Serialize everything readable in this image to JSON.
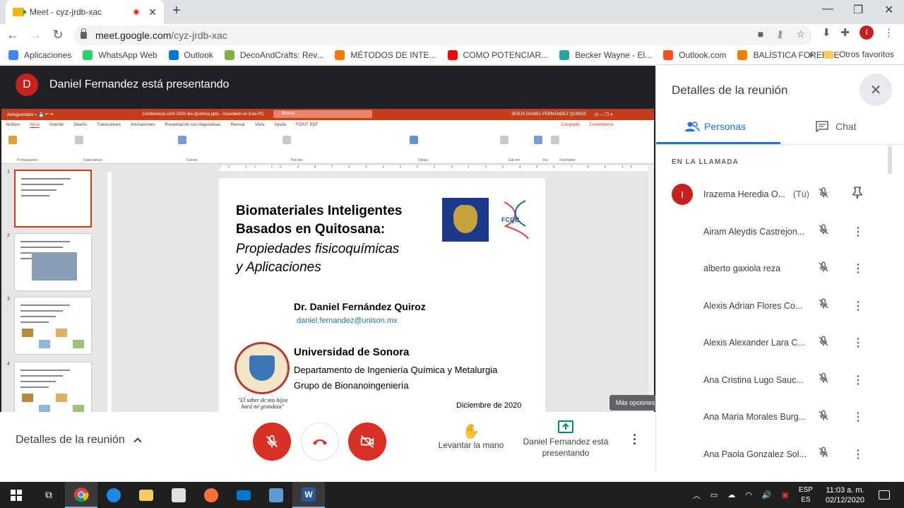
{
  "browser": {
    "tab_title": "Meet - cyz-jrdb-xac",
    "url_host": "meet.google.com",
    "url_path": "/cyz-jrdb-xac",
    "profile_initial": "I"
  },
  "bookmarks": [
    {
      "label": "Aplicaciones",
      "color": "#4285f4"
    },
    {
      "label": "WhatsApp Web",
      "color": "#25d366"
    },
    {
      "label": "Outlook",
      "color": "#0078d4"
    },
    {
      "label": "DecoAndCrafts: Rev...",
      "color": "#7cb342"
    },
    {
      "label": "MÉTODOS DE INTE...",
      "color": "#f57c00"
    },
    {
      "label": "COMO POTENCIAR...",
      "color": "#ff0000"
    },
    {
      "label": "Becker Wayne - El...",
      "color": "#26a69a"
    },
    {
      "label": "Outlook.com",
      "color": "#f25022"
    },
    {
      "label": "BALÍSTICA FORENSE",
      "color": "#f57c00"
    }
  ],
  "bookmarks_folder": "Otros favoritos",
  "presenter": {
    "initial": "D",
    "label": "Daniel Fernandez está presentando"
  },
  "ppt": {
    "title_bar": "Conferencia UAS 2020 día Química.pptx - Guardado en Este PC",
    "search": "Buscar",
    "user": "JESÚS DANIEL FERNÁNDEZ QUIROZ",
    "menu": [
      "Archivo",
      "Inicio",
      "Insertar",
      "Diseño",
      "Transiciones",
      "Animaciones",
      "Presentación con diapositivas",
      "Revisar",
      "Vista",
      "Ayuda",
      "FOXIT PDF"
    ],
    "share": "Compartir",
    "comments": "Comentarios",
    "groups": [
      "Portapapeles",
      "Diapositivas",
      "Fuente",
      "Párrafo",
      "Dibujo",
      "Edición",
      "Voz",
      "Diseñador"
    ],
    "thumb_nums": [
      "1",
      "2",
      "3",
      "4"
    ],
    "slide": {
      "title_line1": "Biomateriales Inteligentes",
      "title_line2": "Basados en Quitosana:",
      "subtitle_line1": "Propiedades fisicoquímicas",
      "subtitle_line2": "y Aplicaciones",
      "author": "Dr. Daniel Fernández Quiroz",
      "email": "daniel.fernandez@unison.mx",
      "university": "Universidad de Sonora",
      "department": "Departamento de Ingeniería Química y Metalurgia",
      "group": "Grupo de Bionanoingeniería",
      "motto": "\"El saber de mis hijos hará mi grandeza\"",
      "date": "Diciembre de 2020",
      "logo_text": "FCQB"
    }
  },
  "tooltip": "Más opciones",
  "controls": {
    "meeting_details": "Detalles de la reunión",
    "raise_hand": "Levantar la mano",
    "presenting": "Daniel Fernandez está presentando"
  },
  "panel": {
    "title": "Detalles de la reunión",
    "tab_people": "Personas",
    "tab_chat": "Chat",
    "section": "EN LA LLAMADA",
    "you_label": "(Tú)",
    "participants": [
      {
        "name": "Irazema Heredia O...",
        "initial": "I"
      },
      {
        "name": "Airam Aleydis Castrejon..."
      },
      {
        "name": "alberto gaxiola reza"
      },
      {
        "name": "Alexis Adrian Flores Co..."
      },
      {
        "name": "Alexis Alexander Lara C..."
      },
      {
        "name": "Ana Cristina Lugo Sauc..."
      },
      {
        "name": "Ana Maria Morales Burg..."
      },
      {
        "name": "Ana Paola Gonzalez Sol..."
      }
    ]
  },
  "taskbar": {
    "lang_top": "ESP",
    "lang_bottom": "ES",
    "time": "11:03 a. m.",
    "date": "02/12/2020"
  }
}
